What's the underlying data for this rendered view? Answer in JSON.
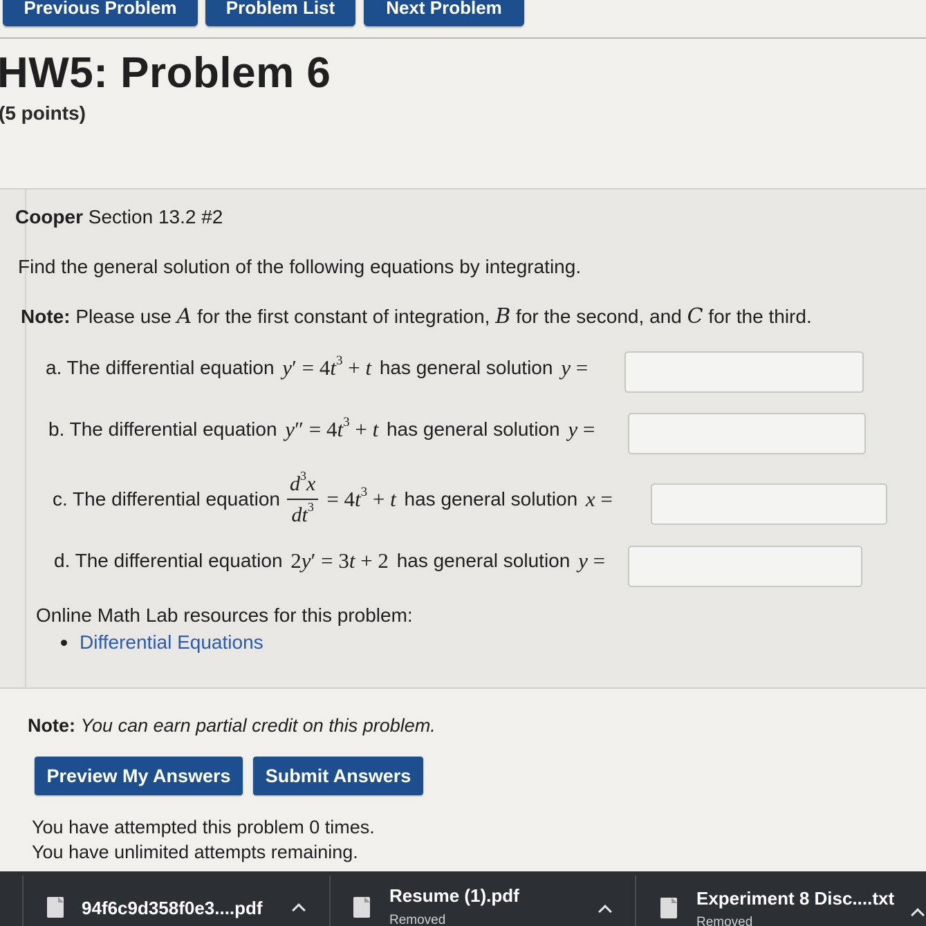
{
  "nav": {
    "prev_label": "Previous Problem",
    "list_label": "Problem List",
    "next_label": "Next Problem"
  },
  "title": "HW5: Problem 6",
  "points": "(5 points)",
  "problem": {
    "source_bold": "Cooper",
    "source_rest": " Section 13.2 #2",
    "instructions": "Find the general solution of the following equations by integrating.",
    "note_label": "Note:",
    "note_parts": [
      " Please use ",
      "A",
      " for the first constant of integration, ",
      "B",
      " for the second, and ",
      "C",
      " for the third."
    ],
    "parts": [
      {
        "label": "a. The differential equation",
        "suffix": "has general solution",
        "answer": ""
      },
      {
        "label": "b. The differential equation",
        "suffix": "has general solution",
        "answer": ""
      },
      {
        "label": "c. The differential equation",
        "suffix": "has general solution",
        "answer": ""
      },
      {
        "label": "d. The differential equation",
        "suffix": "has general solution",
        "answer": ""
      }
    ],
    "resources_title": "Online Math Lab resources for this problem:",
    "resource_link": "Differential Equations"
  },
  "credit_note_label": "Note:",
  "credit_note_text": "You can earn partial credit on this problem.",
  "buttons": {
    "preview": "Preview My Answers",
    "submit": "Submit Answers"
  },
  "attempts": {
    "line1": "You have attempted this problem 0 times.",
    "line2": "You have unlimited attempts remaining."
  },
  "downloads": [
    {
      "name": "94f6c9d358f0e3....pdf",
      "status": ""
    },
    {
      "name": "Resume (1).pdf",
      "status": "Removed"
    },
    {
      "name": "Experiment 8 Disc....txt",
      "status": "Removed"
    }
  ],
  "colors": {
    "button": "#1d4f8f",
    "link": "#2a5bb0",
    "download_bar": "#2c2f33"
  }
}
